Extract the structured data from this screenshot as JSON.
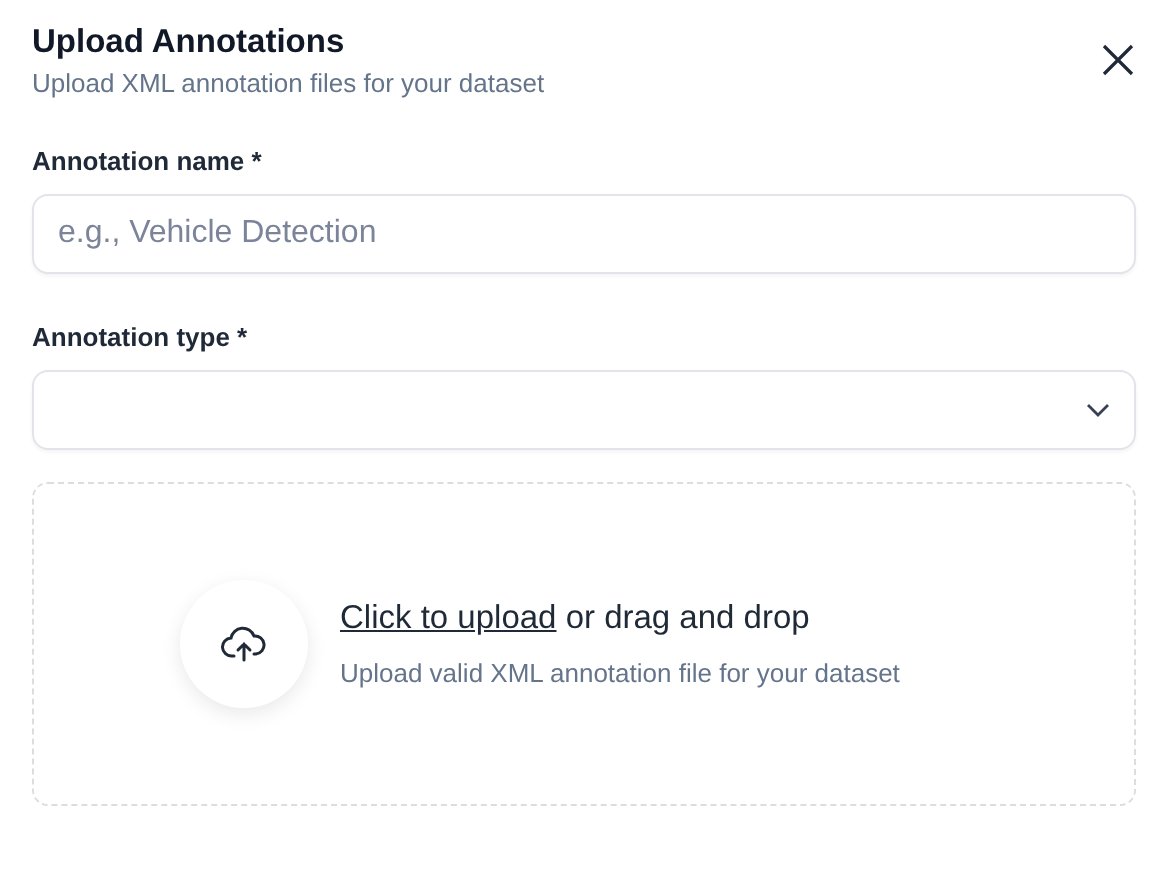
{
  "dialog": {
    "title": "Upload Annotations",
    "subtitle": "Upload XML annotation files for your dataset"
  },
  "fields": [
    {
      "kind": "text",
      "label": "Annotation name *",
      "placeholder": "e.g., Vehicle Detection"
    },
    {
      "kind": "select",
      "label": "Annotation type *"
    }
  ],
  "dropzone": {
    "link": "Click to upload",
    "rest": " or drag and drop",
    "hint": "Upload valid XML annotation file for your dataset"
  }
}
